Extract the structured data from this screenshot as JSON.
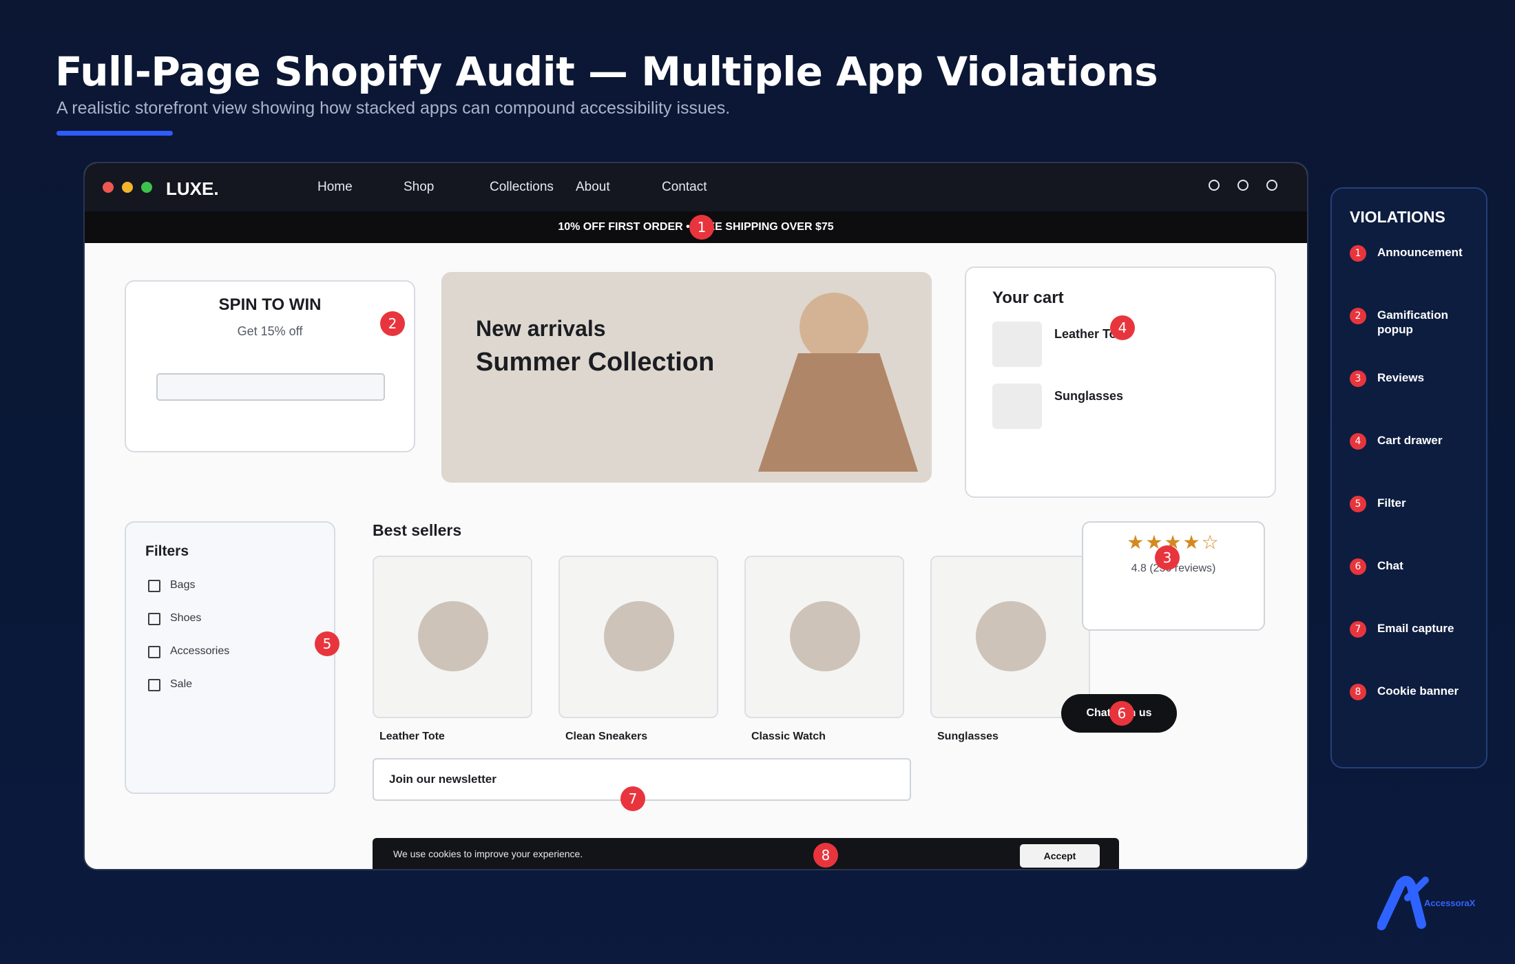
{
  "header": {
    "title": "Full-Page Shopify Audit — Multiple App Violations",
    "subtitle": "A realistic storefront view showing how stacked apps can compound accessibility issues."
  },
  "store": {
    "logo": "LUXE.",
    "nav": [
      "Home",
      "Shop",
      "Collections",
      "About",
      "Contact"
    ],
    "announcement": "10% OFF FIRST ORDER  •  FREE SHIPPING OVER $75",
    "spin": {
      "title": "SPIN TO WIN",
      "subtitle": "Get 15% off"
    },
    "hero": {
      "line1": "New arrivals",
      "line2": "Summer Collection"
    },
    "cart": {
      "title": "Your cart",
      "items": [
        "Leather Tote",
        "Sunglasses"
      ]
    },
    "filters": {
      "title": "Filters",
      "items": [
        "Bags",
        "Shoes",
        "Accessories",
        "Sale"
      ]
    },
    "best_sellers": {
      "title": "Best sellers",
      "products": [
        "Leather Tote",
        "Clean Sneakers",
        "Classic Watch",
        "Sunglasses"
      ]
    },
    "reviews": {
      "stars": "★★★★☆",
      "rating_text": "4.8 (230 reviews)",
      "rating": 4,
      "rating_max": 5
    },
    "chat_label": "Chat with us",
    "newsletter_label": "Join our newsletter",
    "cookie": {
      "text": "We use cookies to improve your experience.",
      "accept": "Accept"
    }
  },
  "badges": [
    "1",
    "2",
    "3",
    "4",
    "5",
    "6",
    "7",
    "8"
  ],
  "violations": {
    "title": "VIOLATIONS",
    "items": [
      {
        "num": "1",
        "label": "Announcement"
      },
      {
        "num": "2",
        "label": "Gamification popup"
      },
      {
        "num": "3",
        "label": "Reviews"
      },
      {
        "num": "4",
        "label": "Cart drawer"
      },
      {
        "num": "5",
        "label": "Filter"
      },
      {
        "num": "6",
        "label": "Chat"
      },
      {
        "num": "7",
        "label": "Email capture"
      },
      {
        "num": "8",
        "label": "Cookie banner"
      }
    ]
  },
  "brand": {
    "name": "AccessoraX"
  },
  "colors": {
    "background": "#0b1733",
    "accent": "#2f5bff",
    "badge": "#e8353d",
    "star": "#d4891f"
  }
}
